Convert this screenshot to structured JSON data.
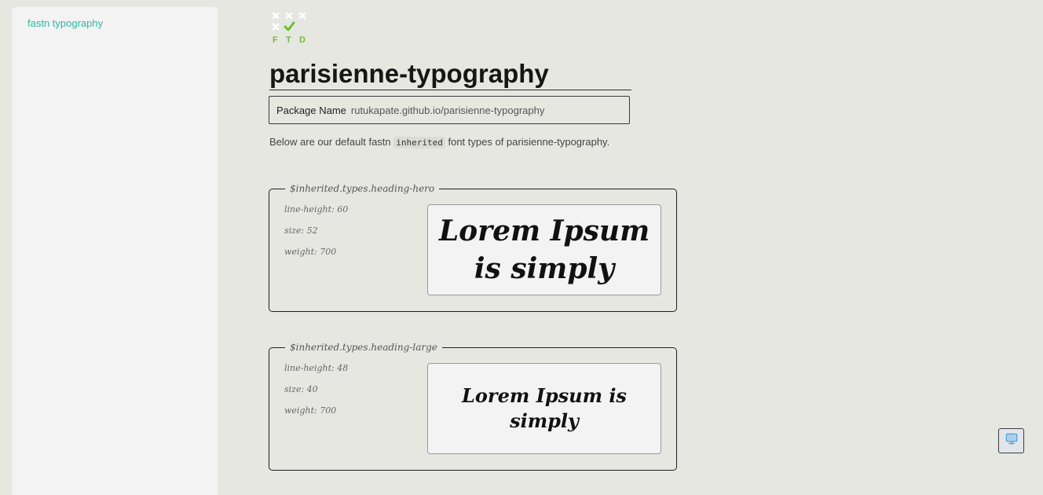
{
  "sidebar": {
    "items": [
      {
        "label": "fastn typography"
      }
    ]
  },
  "logo": {
    "letters": [
      "F",
      "T",
      "D"
    ],
    "accent_color": "#6abf2e",
    "icon": "ftd-logo-icon"
  },
  "header": {
    "title": "parisienne-typography"
  },
  "package": {
    "label": "Package Name",
    "value": "rutukapate.github.io/parisienne-typography"
  },
  "description": {
    "before": "Below are our default fastn ",
    "code": "inherited",
    "after": " font types of parisienne-typography."
  },
  "cards": [
    {
      "name": "$inherited.types.heading-hero",
      "line_height": "line-height: 60",
      "size": "size: 52",
      "weight": "weight: 700",
      "preview": "Lorem Ipsum is simply"
    },
    {
      "name": "$inherited.types.heading-large",
      "line_height": "line-height: 48",
      "size": "size: 40",
      "weight": "weight: 700",
      "preview": "Lorem Ipsum is simply"
    }
  ],
  "device_toggle": {
    "icon": "desktop-monitor-icon",
    "color": "#4a9fe0"
  }
}
